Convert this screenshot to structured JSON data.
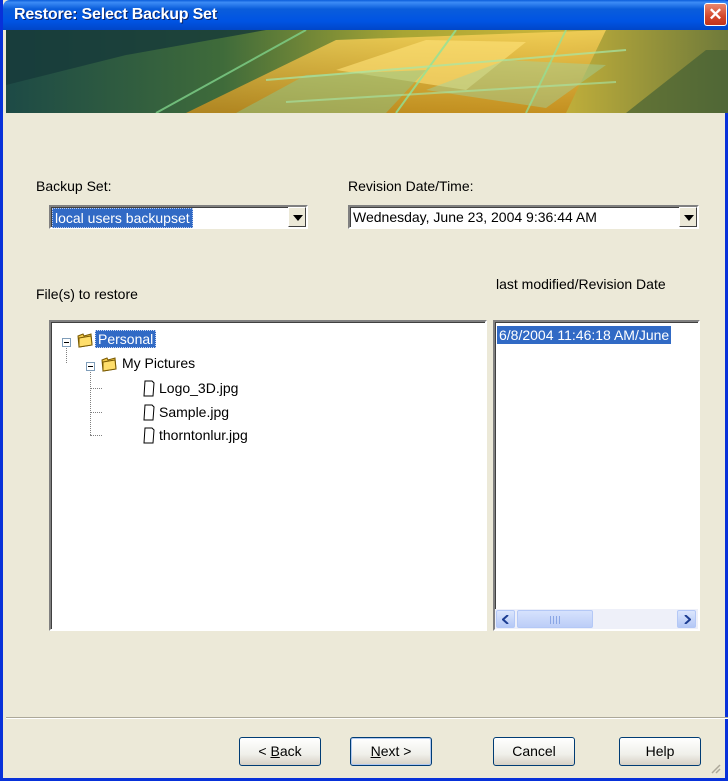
{
  "window": {
    "title": "Restore: Select Backup Set",
    "close_label": "✕"
  },
  "backup_set": {
    "label": "Backup Set:",
    "value": "local users backupset"
  },
  "revision": {
    "label": "Revision Date/Time:",
    "value": "Wednesday, June 23, 2004 9:36:44 AM"
  },
  "files": {
    "label": "File(s) to restore",
    "tree": [
      {
        "label": "Personal",
        "type": "folder",
        "selected": true
      },
      {
        "label": "My Pictures",
        "type": "folder"
      },
      {
        "label": "Logo_3D.jpg",
        "type": "file"
      },
      {
        "label": "Sample.jpg",
        "type": "file"
      },
      {
        "label": "thorntonlur.jpg",
        "type": "file"
      }
    ]
  },
  "revision_list": {
    "label": "last modified/Revision Date",
    "items": [
      "6/8/2004 11:46:18 AM/June"
    ],
    "scroll_grip": "III"
  },
  "buttons": {
    "back": {
      "mnemonic": "B",
      "rest": "ack",
      "prefix": "< "
    },
    "next": {
      "mnemonic": "N",
      "rest": "ext >"
    },
    "cancel": "Cancel",
    "help": "Help"
  },
  "colors": {
    "title_bar": "#0054e3",
    "selection": "#316ac5",
    "dialog_bg": "#ece9d8",
    "folder": "#f2c94c"
  }
}
